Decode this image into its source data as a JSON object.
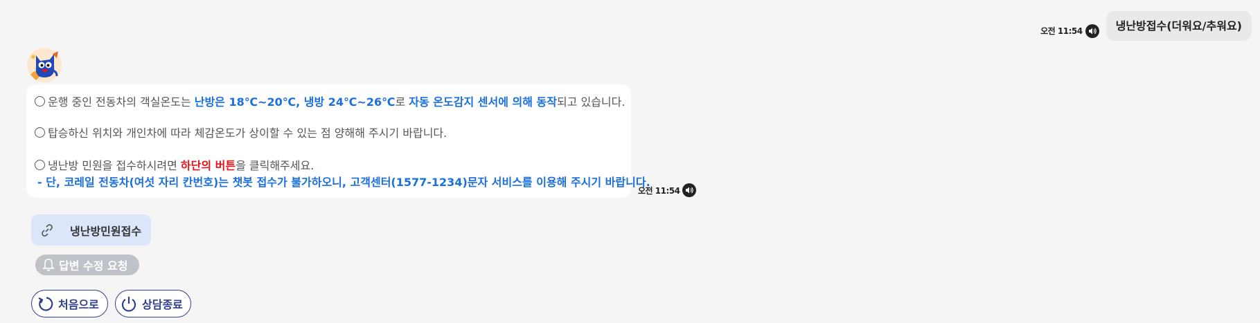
{
  "user_message": {
    "text": "냉난방접수(더워요/추워요)",
    "time": "오전 11:54",
    "speaker_icon": "speaker-icon"
  },
  "bot_message": {
    "avatar_icon": "mascot-avatar-icon",
    "line1": {
      "prefix": "운행 중인 전동차의 객실온도는 ",
      "bold1": "난방은 18℃~20℃, 냉방 24℃~26℃",
      "mid": "로 ",
      "bold2": "자동 온도감지 센서에 의해 동작",
      "suffix": "되고 있습니다."
    },
    "line2": "탑승하신 위치와 개인차에 따라 체감온도가 상이할 수 있는 점 양해해 주시기 바랍니다.",
    "line3": {
      "prefix": "냉난방 민원을 접수하시려면 ",
      "red": "하단의 버튼",
      "suffix": "을 클릭해주세요."
    },
    "note": "- 단, 코레일 전동차(여섯 자리 칸번호)는 챗봇 접수가 불가하오니, 고객센터(1577-1234)문자 서비스를 이용해 주시기 바랍니다.",
    "time": "오전 11:54"
  },
  "link_button": {
    "label": "냉난방민원접수",
    "icon": "link-icon"
  },
  "edit_request": {
    "label": "답변 수정 요청",
    "icon": "bell-icon"
  },
  "buttons": {
    "home": {
      "label": "처음으로",
      "icon": "refresh-icon"
    },
    "end": {
      "label": "상담종료",
      "icon": "power-icon"
    }
  },
  "colors": {
    "background": "#f5f5f5",
    "accent_blue": "#1a6fe0",
    "accent_red": "#e8131a",
    "navy": "#2e3f8a",
    "link_button_bg": "#dce6fa",
    "chip_gray": "#bfc3c9"
  }
}
